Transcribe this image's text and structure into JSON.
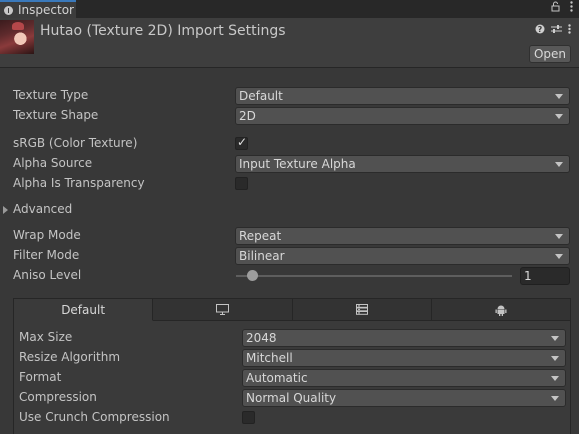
{
  "window": {
    "tab_label": "Inspector",
    "lock_icon": "lock-icon",
    "menu_icon": "kebab-menu-icon"
  },
  "header": {
    "title": "Hutao (Texture 2D) Import Settings",
    "help_icon": "help-icon",
    "settings_icon": "sliders-icon",
    "menu_icon": "kebab-menu-icon",
    "open_label": "Open"
  },
  "fields": {
    "texture_type": {
      "label": "Texture Type",
      "value": "Default"
    },
    "texture_shape": {
      "label": "Texture Shape",
      "value": "2D"
    },
    "srgb": {
      "label": "sRGB (Color Texture)",
      "checked": true
    },
    "alpha_source": {
      "label": "Alpha Source",
      "value": "Input Texture Alpha"
    },
    "alpha_is_transparency": {
      "label": "Alpha Is Transparency",
      "checked": false
    },
    "advanced": {
      "label": "Advanced",
      "expanded": false
    },
    "wrap_mode": {
      "label": "Wrap Mode",
      "value": "Repeat"
    },
    "filter_mode": {
      "label": "Filter Mode",
      "value": "Bilinear"
    },
    "aniso_level": {
      "label": "Aniso Level",
      "value": "1",
      "slider_fraction": 0.06
    }
  },
  "platform": {
    "tabs": [
      {
        "label": "Default",
        "active": true
      },
      {
        "icon": "monitor-icon",
        "label": ""
      },
      {
        "icon": "server-icon",
        "label": ""
      },
      {
        "icon": "android-icon",
        "label": ""
      }
    ],
    "max_size": {
      "label": "Max Size",
      "value": "2048"
    },
    "resize_algorithm": {
      "label": "Resize Algorithm",
      "value": "Mitchell"
    },
    "format": {
      "label": "Format",
      "value": "Automatic"
    },
    "compression": {
      "label": "Compression",
      "value": "Normal Quality"
    },
    "use_crunch": {
      "label": "Use Crunch Compression",
      "checked": false
    }
  },
  "colors": {
    "background": "#383838",
    "tab_accent": "#3a79bb",
    "dropdown_bg": "#515151"
  }
}
